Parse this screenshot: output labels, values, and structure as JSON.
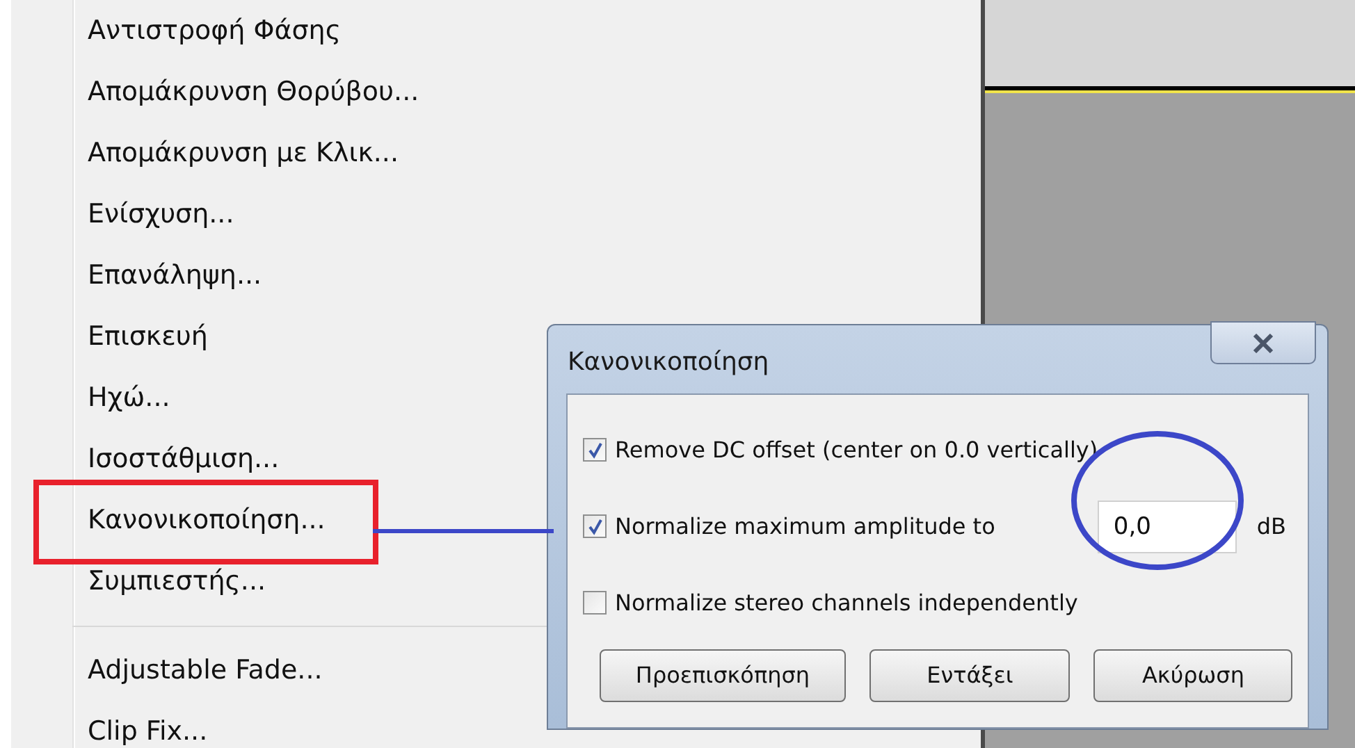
{
  "menu": {
    "items": [
      {
        "kind": "item",
        "label": "Αντιστροφή Φάσης"
      },
      {
        "kind": "item",
        "label": "Απομάκρυνση Θορύβου..."
      },
      {
        "kind": "item",
        "label": "Απομάκρυνση με Κλικ..."
      },
      {
        "kind": "item",
        "label": "Ενίσχυση..."
      },
      {
        "kind": "item",
        "label": "Επανάληψη..."
      },
      {
        "kind": "item",
        "label": "Επισκευή"
      },
      {
        "kind": "item",
        "label": "Ηχώ..."
      },
      {
        "kind": "item",
        "label": "Ισοστάθμιση..."
      },
      {
        "kind": "item",
        "label": "Κανονικοποίηση..."
      },
      {
        "kind": "item",
        "label": "Συμπιεστής..."
      },
      {
        "kind": "separator"
      },
      {
        "kind": "item",
        "label": "Adjustable Fade..."
      },
      {
        "kind": "item",
        "label": "Clip Fix..."
      }
    ]
  },
  "dialog": {
    "title": "Κανονικοποίηση",
    "options": [
      {
        "label": "Remove DC offset (center on 0.0 vertically)",
        "checked": true
      },
      {
        "label": "Normalize maximum amplitude to",
        "checked": true,
        "value": "0,0",
        "unit": "dB"
      },
      {
        "label": "Normalize stereo channels independently",
        "checked": false
      }
    ],
    "buttons": [
      "Προεπισκόπηση",
      "Εντάξει",
      "Ακύρωση"
    ]
  }
}
